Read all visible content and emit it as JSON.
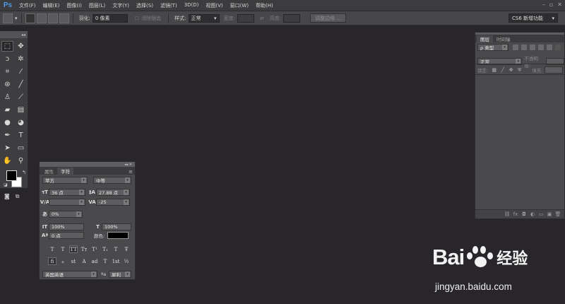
{
  "app": {
    "logo": "Ps"
  },
  "menu": [
    "文件(F)",
    "编辑(E)",
    "图像(I)",
    "图层(L)",
    "文字(Y)",
    "选择(S)",
    "滤镜(T)",
    "3D(D)",
    "视图(V)",
    "窗口(W)",
    "帮助(H)"
  ],
  "window_controls": {
    "minimize": "–",
    "restore": "▫",
    "close": "✕"
  },
  "options_bar": {
    "feather_label": "羽化:",
    "feather_value": "0 像素",
    "antialias_label": "消除锯齿",
    "style_label": "样式:",
    "style_value": "正常",
    "width_label": "宽度:",
    "height_label": "高度:",
    "refine_edge_button": "调整边缘 ...",
    "workspace": "CS6 新增功能"
  },
  "toolbar": {
    "collapse": "◂◂",
    "tools": [
      {
        "name": "marquee-tool",
        "glyph": "⬚",
        "active": true
      },
      {
        "name": "move-tool",
        "glyph": "✥",
        "active": false
      },
      {
        "name": "lasso-tool",
        "glyph": "ↄ",
        "active": false
      },
      {
        "name": "magic-wand-tool",
        "glyph": "✲",
        "active": false
      },
      {
        "name": "crop-tool",
        "glyph": "⌗",
        "active": false
      },
      {
        "name": "eyedropper-tool",
        "glyph": "⁄",
        "active": false
      },
      {
        "name": "healing-brush-tool",
        "glyph": "⊛",
        "active": false
      },
      {
        "name": "brush-tool",
        "glyph": "╱",
        "active": false
      },
      {
        "name": "clone-stamp-tool",
        "glyph": "♙",
        "active": false
      },
      {
        "name": "history-brush-tool",
        "glyph": "⟋",
        "active": false
      },
      {
        "name": "eraser-tool",
        "glyph": "▰",
        "active": false
      },
      {
        "name": "gradient-tool",
        "glyph": "▤",
        "active": false
      },
      {
        "name": "blur-tool",
        "glyph": "●",
        "active": false
      },
      {
        "name": "dodge-tool",
        "glyph": "◕",
        "active": false
      },
      {
        "name": "pen-tool",
        "glyph": "✒",
        "active": false
      },
      {
        "name": "type-tool",
        "glyph": "T",
        "active": false
      },
      {
        "name": "path-selection-tool",
        "glyph": "➤",
        "active": false
      },
      {
        "name": "shape-tool",
        "glyph": "▭",
        "active": false
      },
      {
        "name": "hand-tool",
        "glyph": "✋",
        "active": false
      },
      {
        "name": "zoom-tool",
        "glyph": "⚲",
        "active": false
      }
    ]
  },
  "character_panel": {
    "collapse": "◂◂ ✕",
    "tabs": [
      "属性",
      "字符"
    ],
    "active_tab": "字符",
    "menu_icon": "≡",
    "font_family": "苹方",
    "font_style": "中等",
    "font_size": "36 点",
    "leading": "27.88 点",
    "kerning": "",
    "tracking": "-25",
    "tsume": "0%",
    "vertical_scale": "100%",
    "horizontal_scale": "100%",
    "baseline_shift": "0 点",
    "color_label": "颜色:",
    "text_color": "#000000",
    "format_buttons": [
      "T",
      "T",
      "TT",
      "Tт",
      "T¹",
      "T₁",
      "T",
      "Ŧ"
    ],
    "opentype_buttons": [
      "ﬁ",
      "ℴ",
      "st",
      "A",
      "ad",
      "T",
      "1st",
      "½"
    ],
    "language": "英国英语",
    "aa_label": "ªa",
    "antialias": "犀利"
  },
  "layers_panel": {
    "tabs": [
      "图层",
      "时间轴"
    ],
    "active_tab": "图层",
    "kind_label": "ρ 类型",
    "blend_mode": "正常",
    "opacity_label": "不透明度:",
    "lock_label": "锁定:",
    "fill_label": "填充:",
    "bottom_icons": [
      "⛓",
      "fx",
      "◘",
      "◐",
      "▭",
      "▣",
      "🗑"
    ]
  },
  "watermark": {
    "brand_left": "Bai",
    "brand_right": "经验",
    "url": "jingyan.baidu.com"
  },
  "colors": {
    "canvas": "#28262a",
    "ps_blue": "#4d9be6",
    "panel": "#4a494c"
  }
}
